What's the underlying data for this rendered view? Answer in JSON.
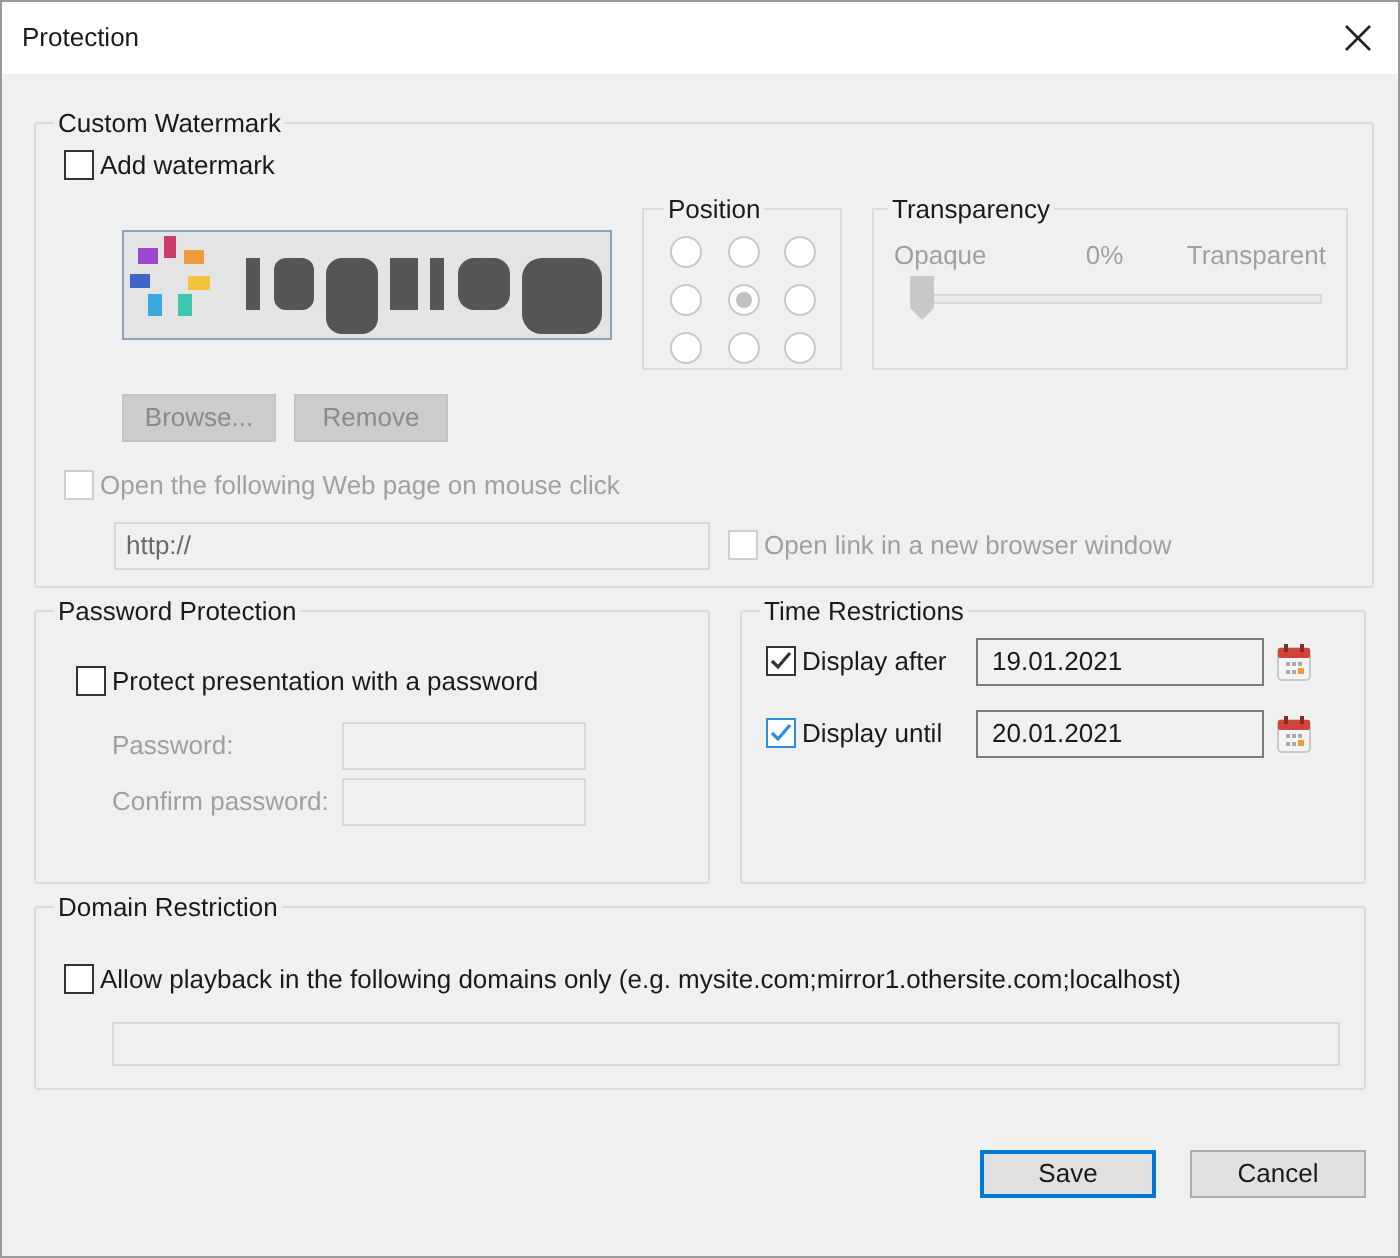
{
  "window": {
    "title": "Protection"
  },
  "custom_watermark": {
    "title": "Custom Watermark",
    "add_watermark": {
      "label": "Add watermark",
      "checked": false
    },
    "position": {
      "title": "Position",
      "options": [
        {
          "selected": false
        },
        {
          "selected": false
        },
        {
          "selected": false
        },
        {
          "selected": false
        },
        {
          "selected": true
        },
        {
          "selected": false
        },
        {
          "selected": false
        },
        {
          "selected": false
        },
        {
          "selected": false
        }
      ]
    },
    "transparency": {
      "title": "Transparency",
      "min_label": "Opaque",
      "value": "0%",
      "max_label": "Transparent",
      "level": 0,
      "disabled": true
    },
    "buttons": [
      {
        "label": "Browse...",
        "disabled": true
      },
      {
        "label": "Remove",
        "disabled": true
      }
    ],
    "open_link": {
      "label": "Open the following Web page on mouse click",
      "checked": false,
      "disabled": true
    },
    "url_field": {
      "value": "http://",
      "disabled": true
    },
    "new_window": {
      "label": "Open link in a new browser window",
      "checked": false,
      "disabled": true
    }
  },
  "password_protection": {
    "title": "Password Protection",
    "protect": {
      "label": "Protect presentation with a password",
      "checked": false
    },
    "fields": [
      {
        "label": "Password:",
        "disabled": true
      },
      {
        "label": "Confirm password:",
        "disabled": true
      }
    ]
  },
  "time_restrictions": {
    "title": "Time Restrictions",
    "rows": [
      {
        "label": "Display after",
        "checked": true,
        "highlighted": false,
        "value": "19.01.2021"
      },
      {
        "label": "Display until",
        "checked": true,
        "highlighted": true,
        "value": "20.01.2021"
      }
    ]
  },
  "domain_restriction": {
    "title": "Domain Restriction",
    "allow": {
      "label": "Allow playback in the following domains only (e.g. mysite.com;mirror1.othersite.com;localhost)",
      "checked": false
    },
    "field": {
      "disabled": true
    }
  },
  "buttons": [
    {
      "label": "Save",
      "default": true
    },
    {
      "label": "Cancel",
      "default": false
    }
  ]
}
